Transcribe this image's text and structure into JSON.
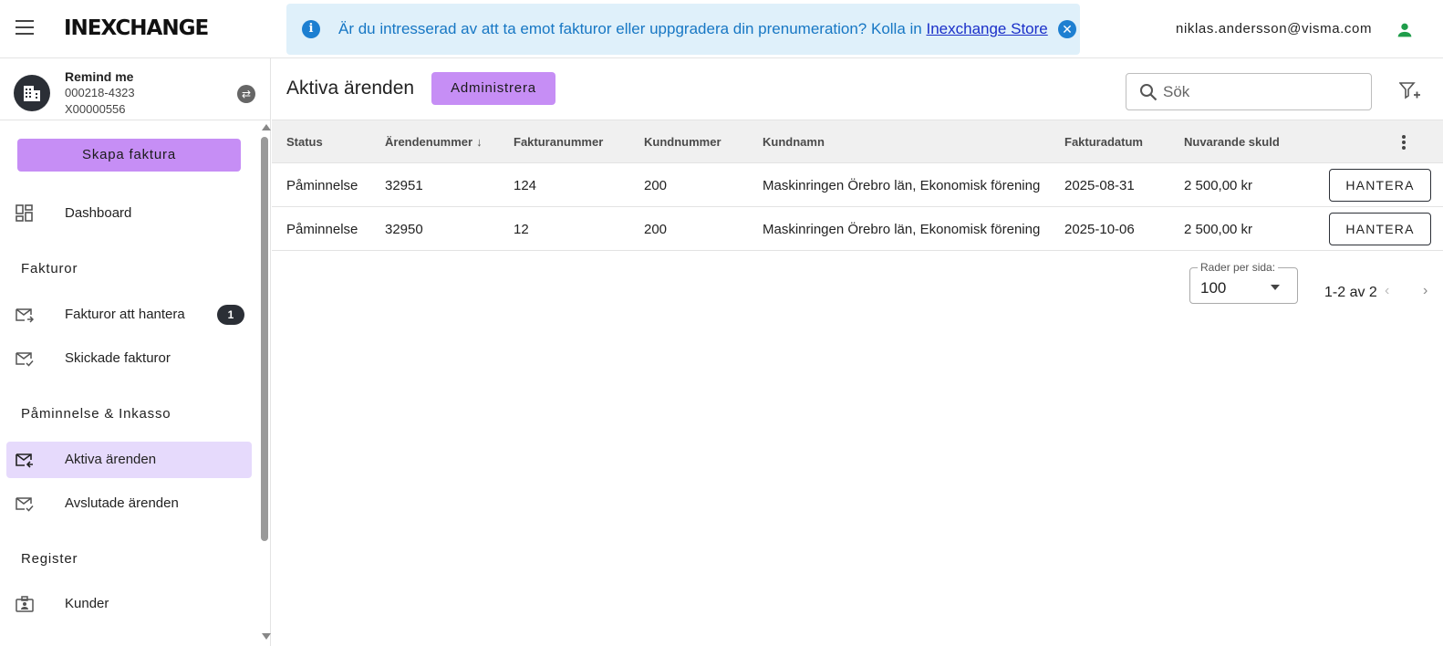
{
  "header": {
    "logo": "INEXCHANGE",
    "banner": {
      "text": "Är du intresserad av att ta emot fakturor eller uppgradera din prenumeration? Kolla in",
      "link": "Inexchange Store"
    },
    "user_email": "niklas.andersson@visma.com"
  },
  "company": {
    "name": "Remind me",
    "line1": "000218-4323",
    "line2": "X00000556"
  },
  "sidebar": {
    "create_label": "Skapa faktura",
    "dashboard": "Dashboard",
    "sections": {
      "invoices": "Fakturor",
      "reminders": "Påminnelse & Inkasso",
      "register": "Register"
    },
    "items": {
      "to_handle": "Fakturor att hantera",
      "to_handle_badge": "1",
      "sent": "Skickade fakturor",
      "active": "Aktiva ärenden",
      "closed": "Avslutade ärenden",
      "customers": "Kunder"
    }
  },
  "main": {
    "title": "Aktiva ärenden",
    "admin_label": "Administrera",
    "search_placeholder": "Sök",
    "columns": [
      "Status",
      "Ärendenummer",
      "Fakturanummer",
      "Kundnummer",
      "Kundnamn",
      "Fakturadatum",
      "Nuvarande skuld"
    ],
    "rows": [
      {
        "status": "Påminnelse",
        "case": "32951",
        "invoice": "124",
        "customer_no": "200",
        "customer_name": "Maskinringen Örebro län, Ekonomisk förening",
        "date": "2025-08-31",
        "debt": "2 500,00 kr"
      },
      {
        "status": "Påminnelse",
        "case": "32950",
        "invoice": "12",
        "customer_no": "200",
        "customer_name": "Maskinringen Örebro län, Ekonomisk förening",
        "date": "2025-10-06",
        "debt": "2 500,00 kr"
      }
    ],
    "row_action": "HANTERA",
    "pagination": {
      "rows_label": "Rader per sida:",
      "rows_value": "100",
      "range": "1-2 av 2"
    }
  },
  "colors": {
    "accent": "#c68ef5",
    "active_nav": "#e6dafc",
    "banner_bg": "#dff0fa",
    "banner_text": "#1777c4",
    "user_icon": "#1f9d4a"
  },
  "icons": {
    "hamburger": "menu-icon",
    "info": "info-icon",
    "close": "close-icon",
    "user": "person-icon",
    "switch": "swap-icon",
    "search": "search-icon",
    "filter": "filter-add-icon",
    "sort": "arrow-down-icon",
    "more": "more-vert-icon"
  }
}
